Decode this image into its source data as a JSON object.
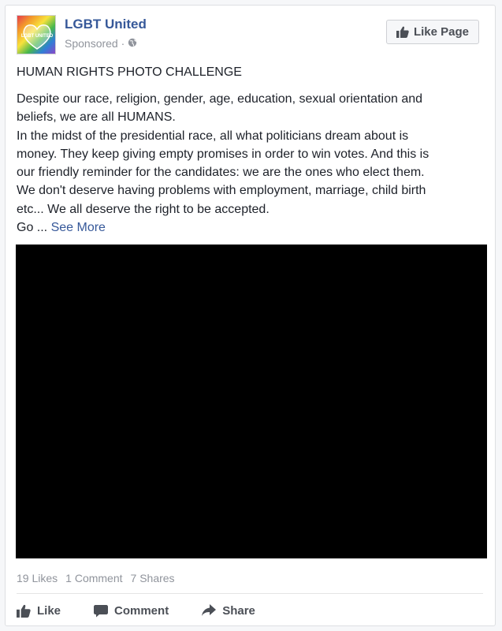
{
  "post": {
    "page_name": "LGBT United",
    "sponsored": "Sponsored ·",
    "like_page_label": "Like Page",
    "headline": "HUMAN RIGHTS PHOTO CHALLENGE",
    "body_lines": [
      "Despite our race, religion, gender, age, education, sexual orientation and",
      "beliefs, we are all HUMANS.",
      "In the midst of the presidential race, all what politicians dream about is",
      "money. They keep giving empty promises in order to win votes. And this is",
      "our friendly reminder for the candidates: we are the ones who elect them.",
      "We don't deserve having problems with employment, marriage, child birth",
      "etc... We all deserve the right to be accepted."
    ],
    "truncated_start": "Go ...",
    "see_more": "See More",
    "avatar_text": "LGBT UNITED"
  },
  "stats": {
    "likes": "19 Likes",
    "comments": "1 Comment",
    "shares": "7 Shares"
  },
  "actions": {
    "like": "Like",
    "comment": "Comment",
    "share": "Share"
  },
  "colors": {
    "link_blue": "#365899",
    "text": "#1d2129",
    "muted": "#90949c",
    "button_text": "#4b4f56"
  },
  "icons": {
    "globe": "globe-icon",
    "thumbs_up": "thumbs-up-icon",
    "comment": "comment-icon",
    "share": "share-icon"
  }
}
